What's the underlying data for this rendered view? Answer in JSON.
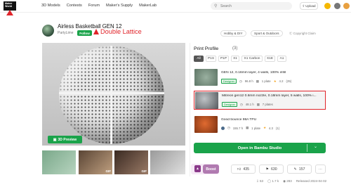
{
  "nav": {
    "logo_line1": "Maker",
    "logo_line2": "World",
    "links": [
      "3D Models",
      "Contests",
      "Forum",
      "Maker's Supply",
      "MakerLab"
    ],
    "search_placeholder": "Search",
    "upload_label": "Upload",
    "colors": {
      "accent": "#1aa34a",
      "annotation": "#e0242a"
    }
  },
  "header": {
    "title": "Airless Basketball GEN 12",
    "author": "PartyLime",
    "follow_label": "Follow",
    "annotation": "Double Lattice",
    "tags": [
      "Hobby & DIY",
      "Sport & Outdoors"
    ],
    "license": "Copyright Claim"
  },
  "media": {
    "preview_label": "3D Preview",
    "thumb_badges": [
      "GIF",
      "GIF"
    ]
  },
  "print_profile": {
    "title": "Print Profile",
    "count": "(3)",
    "filters": [
      "All",
      "P1S",
      "P1P",
      "X1",
      "X1 Carbon",
      "X1E",
      "A1"
    ],
    "profiles": [
      {
        "name": "GEN 12, 0.16mm layer, 4 walls, 100% infill",
        "badge": "Designer",
        "time": "96.8 h",
        "plates": "1 plate",
        "rating": "4.2",
        "rating_count": "(25)"
      },
      {
        "name": "Mitreon gen12 0.6mm nozzle, 0.18mm layer, 5 walls, 100% i...",
        "badge": "Designer",
        "time": "48.1 h",
        "plates": "7 plates",
        "rating": "",
        "rating_count": ""
      },
      {
        "name": "Good bounce 98A TPU",
        "badge": "",
        "time": "155.7 h",
        "plates": "1 plate",
        "rating": "4.3",
        "rating_count": "(1)"
      }
    ],
    "open_label": "Open in Bambu Studio"
  },
  "actions": {
    "boost_label": "Boost",
    "likes": "435",
    "collects": "630",
    "comments": "157"
  },
  "stats": {
    "downloads": "53",
    "prints": "1.7 k",
    "views": "283",
    "released": "Released 2024-04-02"
  }
}
